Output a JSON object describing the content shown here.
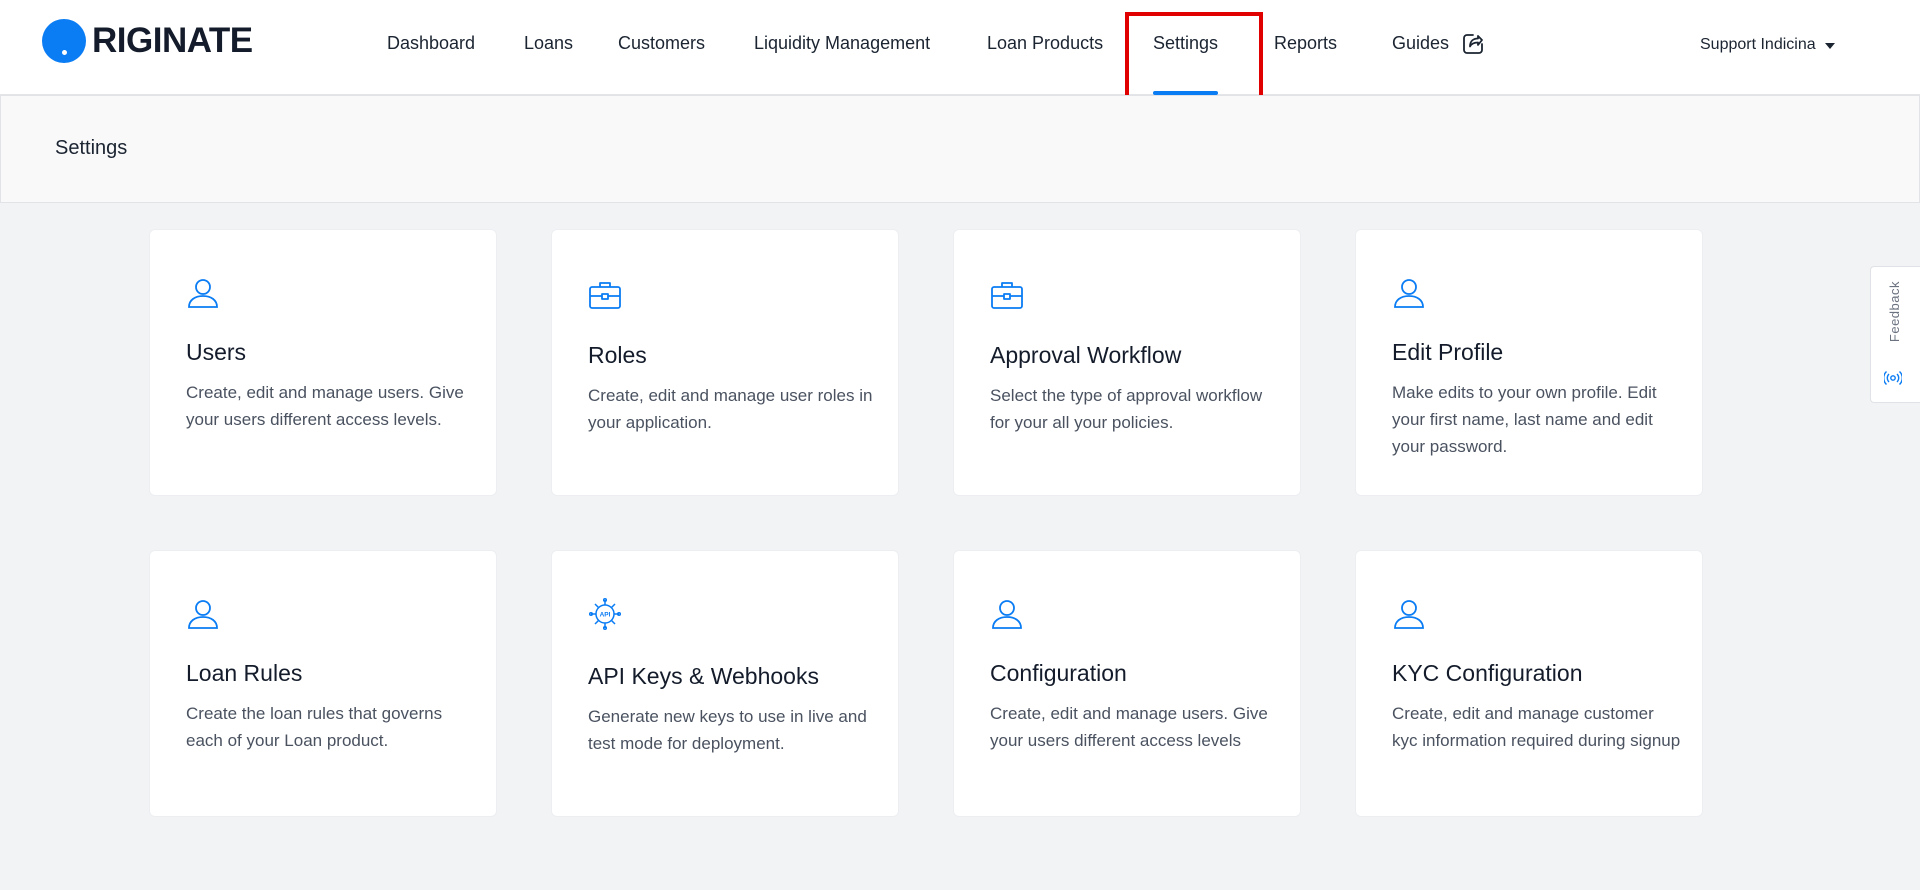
{
  "brand": {
    "logo_text": "RIGINATE",
    "accent": "#0a7cf4"
  },
  "nav": {
    "items": [
      {
        "label": "Dashboard"
      },
      {
        "label": "Loans"
      },
      {
        "label": "Customers"
      },
      {
        "label": "Liquidity Management"
      },
      {
        "label": "Loan Products"
      },
      {
        "label": "Settings",
        "active": true
      },
      {
        "label": "Reports"
      },
      {
        "label": "Guides",
        "icon": "external-link-icon"
      }
    ]
  },
  "user_menu": {
    "label": "Support Indicina",
    "icon": "caret-down-icon"
  },
  "page": {
    "title": "Settings"
  },
  "cards": [
    {
      "icon": "user-icon",
      "title": "Users",
      "description": "Create, edit and manage users. Give your users different access levels."
    },
    {
      "icon": "briefcase-icon",
      "title": "Roles",
      "description": "Create, edit and manage user roles in your application."
    },
    {
      "icon": "briefcase-icon",
      "title": "Approval Workflow",
      "description": "Select the type of approval workflow for your all your policies."
    },
    {
      "icon": "user-icon",
      "title": "Edit Profile",
      "description": "Make edits to your own profile. Edit your first name, last name and edit your password."
    },
    {
      "icon": "user-icon",
      "title": "Loan Rules",
      "description": "Create the loan rules that governs each of your Loan product."
    },
    {
      "icon": "api-gear-icon",
      "title": "API Keys & Webhooks",
      "description": "Generate new keys to use in live and test mode for deployment."
    },
    {
      "icon": "user-icon",
      "title": "Configuration",
      "description": "Create, edit and manage users. Give your users different access levels"
    },
    {
      "icon": "user-icon",
      "title": "KYC Configuration",
      "description": "Create, edit and manage customer kyc information required during signup"
    }
  ],
  "feedback": {
    "label": "Feedback",
    "icon": "feedback-icon"
  },
  "api_icon_text": "API"
}
